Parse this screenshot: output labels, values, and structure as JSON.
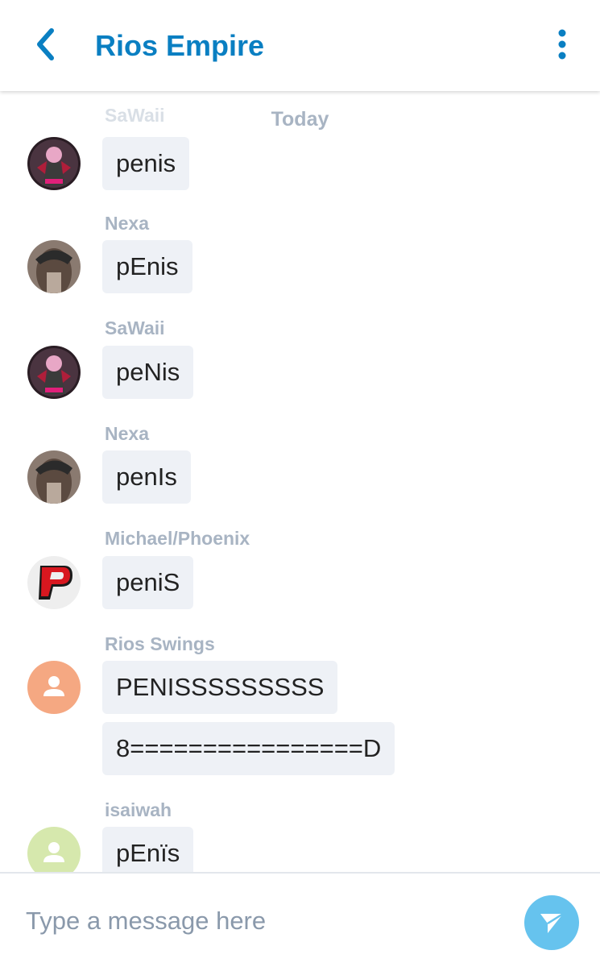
{
  "header": {
    "title": "Rios Empire",
    "back_icon": "chevron-left-icon",
    "menu_icon": "more-vertical-icon"
  },
  "date_separator": "Today",
  "messages": [
    {
      "sender": "SaWaii",
      "text": "penis",
      "avatar": "sawaii-anime-avatar"
    },
    {
      "sender": "Nexa",
      "text": "pEnis",
      "avatar": "nexa-photo-avatar"
    },
    {
      "sender": "SaWaii",
      "text": "peNis",
      "avatar": "sawaii-anime-avatar"
    },
    {
      "sender": "Nexa",
      "text": "penIs",
      "avatar": "nexa-photo-avatar"
    },
    {
      "sender": "Michael/Phoenix",
      "text": "peniS",
      "avatar": "red-p-logo-avatar"
    },
    {
      "sender": "Rios Swings",
      "text": "PENISSSSSSSSS",
      "avatar": "default-user-avatar"
    },
    {
      "sender": "",
      "text": "8================D",
      "avatar": ""
    },
    {
      "sender": "isaiwah",
      "text": "pEnïs",
      "avatar": "default-user-avatar"
    }
  ],
  "composer": {
    "placeholder": "Type a message here",
    "send_icon": "send-icon"
  },
  "colors": {
    "accent": "#0a7fc2",
    "send_button": "#66c3ee",
    "bubble": "#eef1f6",
    "meta_text": "#a8b4c3",
    "avatar_orange": "#f5a882",
    "avatar_green": "#d6e8ad"
  }
}
